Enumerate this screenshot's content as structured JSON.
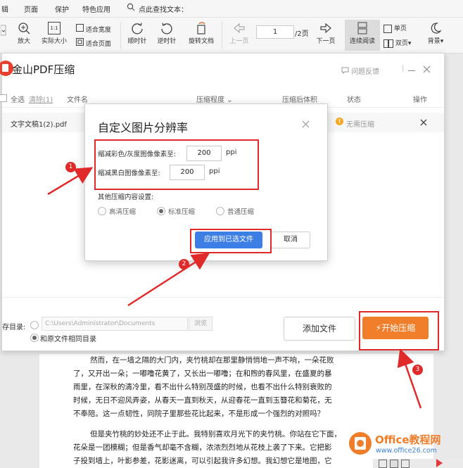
{
  "menu": {
    "items": [
      "辑",
      "页面",
      "保护",
      "特色应用"
    ],
    "search_label": "点此查找文本："
  },
  "toolbar": {
    "zoom_in": "放大",
    "actual_size": "实际大小",
    "fit_width": "适合宽度",
    "fit_page": "适合页面",
    "rotate_cw": "顺时针",
    "rotate_ccw": "逆时针",
    "rotate_doc": "旋转文档",
    "prev_page": "上一页",
    "page_current": "1",
    "page_total": "/2页",
    "next_page": "下一页",
    "continuous": "连续阅读",
    "single": "单页",
    "double": "双页",
    "background": "背景",
    "ratio_icon": "1:1"
  },
  "compress_dialog": {
    "title": "金山PDF压缩",
    "feedback": "问题反馈",
    "minimize_icon": "minimize-icon",
    "close_icon": "close-icon",
    "headers": {
      "select_all": "全选",
      "clear": "清除(1)",
      "filename": "文件名",
      "level": "压缩程度",
      "after": "压缩后体积",
      "status": "状态",
      "operation": "操作"
    },
    "file_row": {
      "name": "文字文稿1(2).pdf",
      "status": "无需压缩"
    },
    "save_label": "存目录:",
    "save_path": "C:\\Users\\Administrator\\Documents",
    "browse": "浏览",
    "same_dir": "和原文件相同目录",
    "add_file": "添加文件",
    "start": "开始压缩"
  },
  "resolution_dialog": {
    "title": "自定义图片分辨率",
    "color_label": "缩减彩色/灰度图像像素至:",
    "color_value": "200",
    "mono_label": "缩减黑白图像像素至:",
    "mono_value": "200",
    "unit": "ppi",
    "other_settings": "其他压缩内容设置:",
    "options": [
      "高清压缩",
      "标准压缩",
      "普通压缩"
    ],
    "selected_option": "标准压缩",
    "apply": "应用到已选文件",
    "cancel": "取消"
  },
  "annotations": [
    "1",
    "2",
    "3"
  ],
  "document": {
    "paragraph1": [
      "然而，在一墙之隔的大门内，夹竹桃却在那里静悄悄地一声不响，一朵花败",
      "了，又开出一朵；一嘟噜花黄了，又长出一嘟噜；在和煦的春风里，在盛夏的暴",
      "雨里，在深秋的清冷里，看不出什么特别茂盛的时候，也看不出什么特别衰败的",
      "时候，无日不迎风弄姿，从春天一直到秋天，从迎春花一直到玉簪花和菊花，无",
      "不奉陪。这一点韧性，同院子里那些花比起来，不是形成一个强烈的对照吗？"
    ],
    "paragraph2": [
      "但是夹竹桃的妙处还不止于此。我特别喜欢月光下的夹竹桃。你站在它下面，",
      "花朵是一团模糊；但是香气却毫不含糊，浓浓烈烈地从花枝上袭了下来。它把影",
      "子投到墙上，叶影参差，花影迷离，可以引起我许多幻想。我幻想它是地图，它"
    ]
  },
  "watermark": {
    "brand": "Office教程网",
    "url": "www.office26.com"
  },
  "colors": {
    "accent_orange": "#f07d2a",
    "apply_blue": "#3d7ee5",
    "annotation_red": "#e02a2a",
    "status_orange": "#f5a623"
  }
}
